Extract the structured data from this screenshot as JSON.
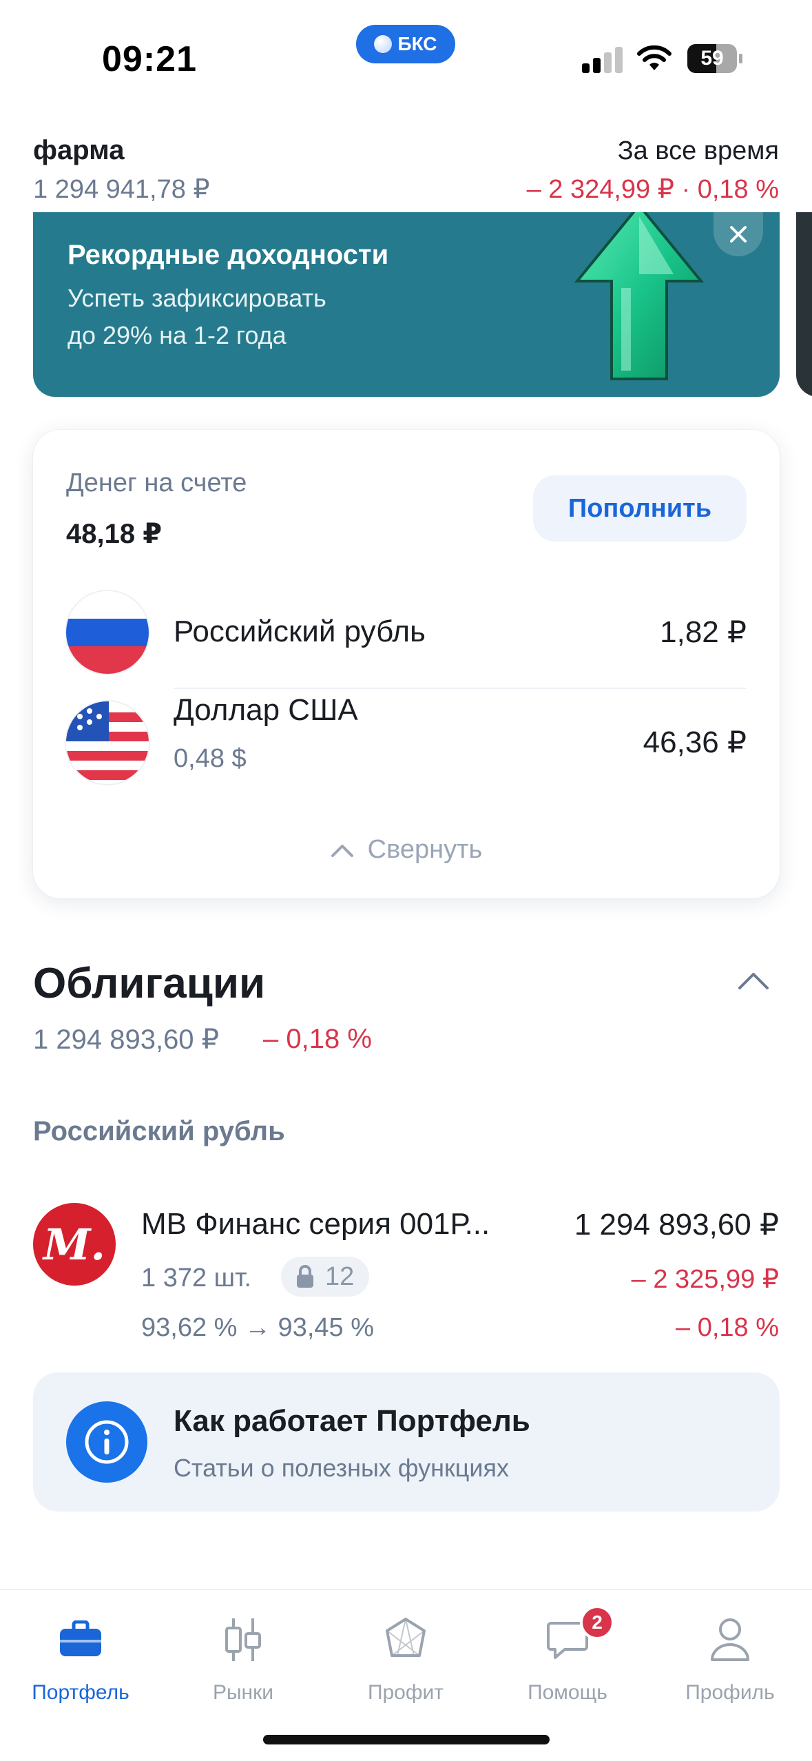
{
  "status_bar": {
    "time": "09:21",
    "island_label": "БКС",
    "battery_level": 59,
    "battery_text": "59"
  },
  "header": {
    "portfolio_name": "фарма",
    "portfolio_total": "1 294 941,78 ₽",
    "period_label": "За все время",
    "period_change": "– 2 324,99 ₽ · 0,18 %"
  },
  "promo": {
    "title": "Рекордные доходности",
    "line1": "Успеть зафиксировать",
    "line2": "до 29% на 1-2 года",
    "icon": "green-up-arrow",
    "close_icon": "close-icon"
  },
  "money": {
    "label": "Денег на счете",
    "value": "48,18 ₽",
    "topup_label": "Пополнить",
    "currencies": [
      {
        "name": "Российский рубль",
        "sub": "",
        "value": "1,82 ₽",
        "flag": "russia-flag-icon"
      },
      {
        "name": "Доллар США",
        "sub": "0,48 $",
        "value": "46,36 ₽",
        "flag": "usa-flag-icon"
      }
    ],
    "collapse_label": "Свернуть"
  },
  "bonds": {
    "title": "Облигации",
    "total": "1 294 893,60 ₽",
    "change": "– 0,18 %",
    "group_title": "Российский рубль",
    "items": [
      {
        "name": "МВ Финанс серия 001Р...",
        "value": "1 294 893,60 ₽",
        "qty": "1 372 шт.",
        "locked": "12",
        "change_abs": "– 2 325,99 ₽",
        "price_range": "93,62 % → 93,45 %",
        "change_pct": "– 0,18 %",
        "logo_letter": "М."
      }
    ]
  },
  "info_card": {
    "title": "Как работает Портфель",
    "subtitle": "Статьи о полезных функциях"
  },
  "tabs": [
    {
      "label": "Портфель",
      "icon": "briefcase-icon",
      "active": true
    },
    {
      "label": "Рынки",
      "icon": "candlestick-icon",
      "active": false
    },
    {
      "label": "Профит",
      "icon": "hexagon-icon",
      "active": false
    },
    {
      "label": "Помощь",
      "icon": "chat-icon",
      "active": false,
      "badge": "2"
    },
    {
      "label": "Профиль",
      "icon": "person-icon",
      "active": false
    }
  ],
  "colors": {
    "accent": "#1a66d9",
    "negative": "#d8344b",
    "promo_bg": "#267a8d",
    "secondary_text": "#6b7a90"
  }
}
